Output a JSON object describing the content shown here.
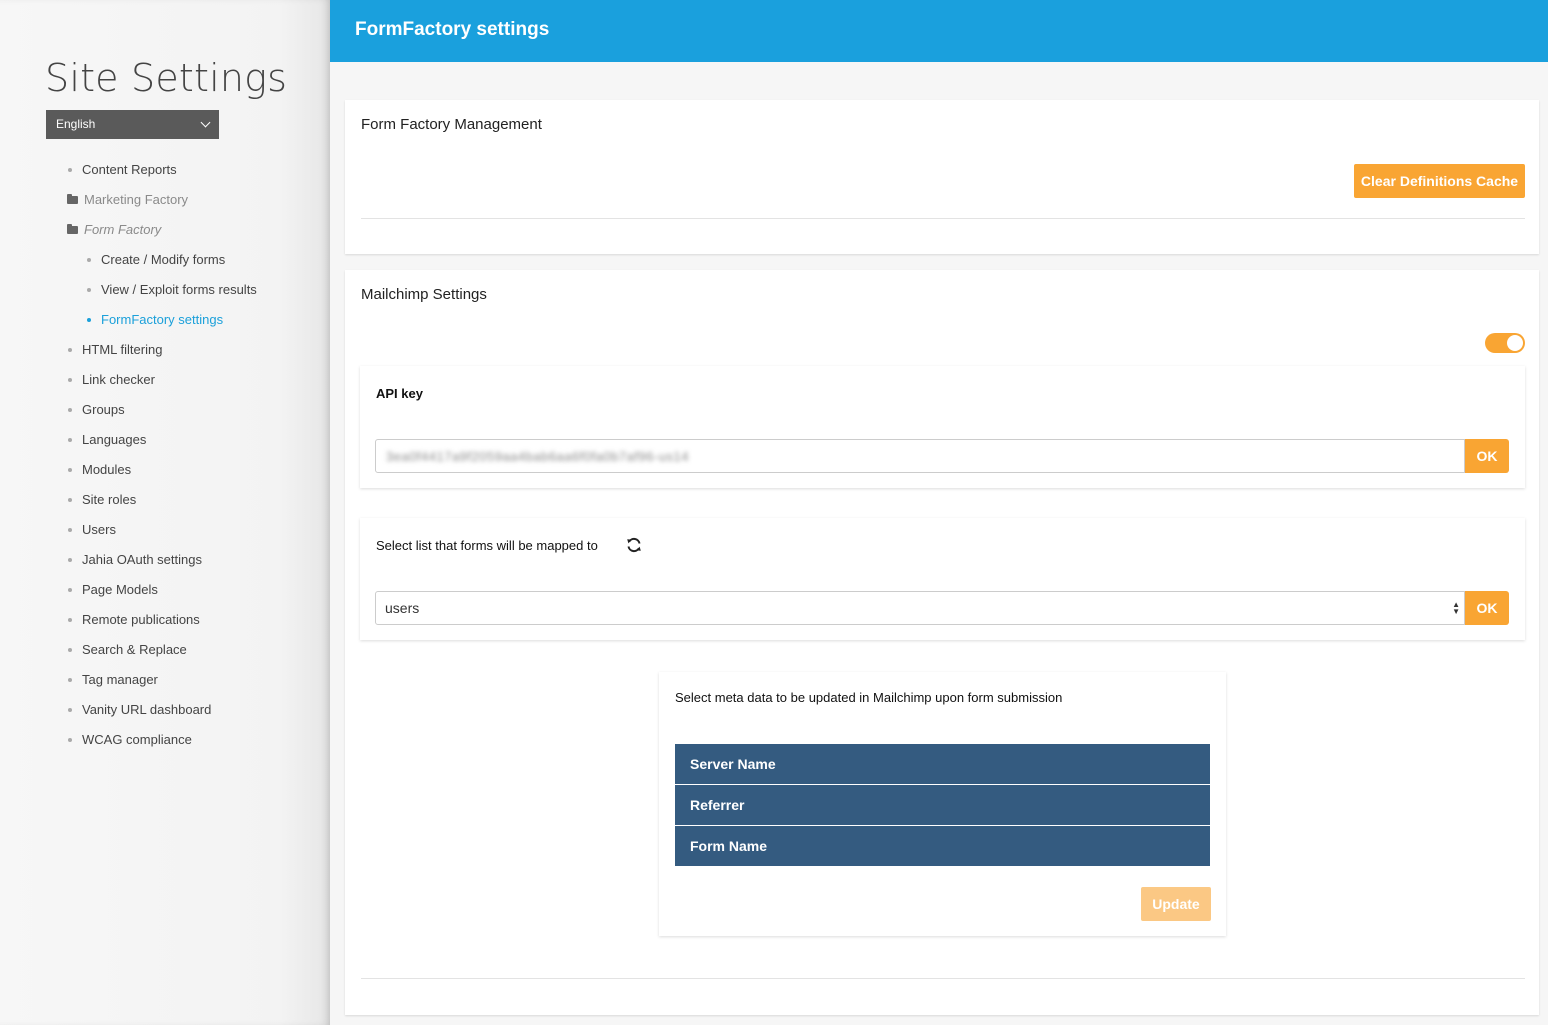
{
  "sidebar": {
    "title": "Site Settings",
    "language": "English",
    "items": [
      {
        "label": "Content Reports",
        "kind": "bullet"
      },
      {
        "label": "Marketing Factory",
        "kind": "folder"
      },
      {
        "label": "Form Factory",
        "kind": "folder"
      },
      {
        "label": "Create / Modify forms",
        "kind": "sub"
      },
      {
        "label": "View / Exploit forms results",
        "kind": "sub"
      },
      {
        "label": "FormFactory settings",
        "kind": "sub-active"
      },
      {
        "label": "HTML filtering",
        "kind": "bullet"
      },
      {
        "label": "Link checker",
        "kind": "bullet"
      },
      {
        "label": "Groups",
        "kind": "bullet"
      },
      {
        "label": "Languages",
        "kind": "bullet"
      },
      {
        "label": "Modules",
        "kind": "bullet"
      },
      {
        "label": "Site roles",
        "kind": "bullet"
      },
      {
        "label": "Users",
        "kind": "bullet"
      },
      {
        "label": "Jahia OAuth settings",
        "kind": "bullet"
      },
      {
        "label": "Page Models",
        "kind": "bullet"
      },
      {
        "label": "Remote publications",
        "kind": "bullet"
      },
      {
        "label": "Search & Replace",
        "kind": "bullet"
      },
      {
        "label": "Tag manager",
        "kind": "bullet"
      },
      {
        "label": "Vanity URL dashboard",
        "kind": "bullet"
      },
      {
        "label": "WCAG compliance",
        "kind": "bullet"
      }
    ]
  },
  "header": {
    "title": "FormFactory settings"
  },
  "management": {
    "title": "Form Factory Management",
    "clear_cache_label": "Clear Definitions Cache"
  },
  "mailchimp": {
    "title": "Mailchimp Settings",
    "toggle_on": true,
    "api_key_label": "API key",
    "api_key_value": "3ea0f4417a9f2059aa4bab6aa6f0fa0b7af96-us14",
    "ok_label": "OK",
    "list_label": "Select list that forms will be mapped to",
    "list_value": "users",
    "meta_label": "Select meta data to be updated in Mailchimp upon form submission",
    "meta_rows": [
      "Server Name",
      "Referrer",
      "Form Name"
    ],
    "update_label": "Update"
  },
  "icons": {
    "refresh": "refresh-icon",
    "chevron": "chevron-down-icon",
    "folder": "folder-icon"
  },
  "colors": {
    "header": "#1aa0dd",
    "accent": "#f9a533",
    "active_link": "#1ba0da",
    "meta_row": "#345b80"
  }
}
